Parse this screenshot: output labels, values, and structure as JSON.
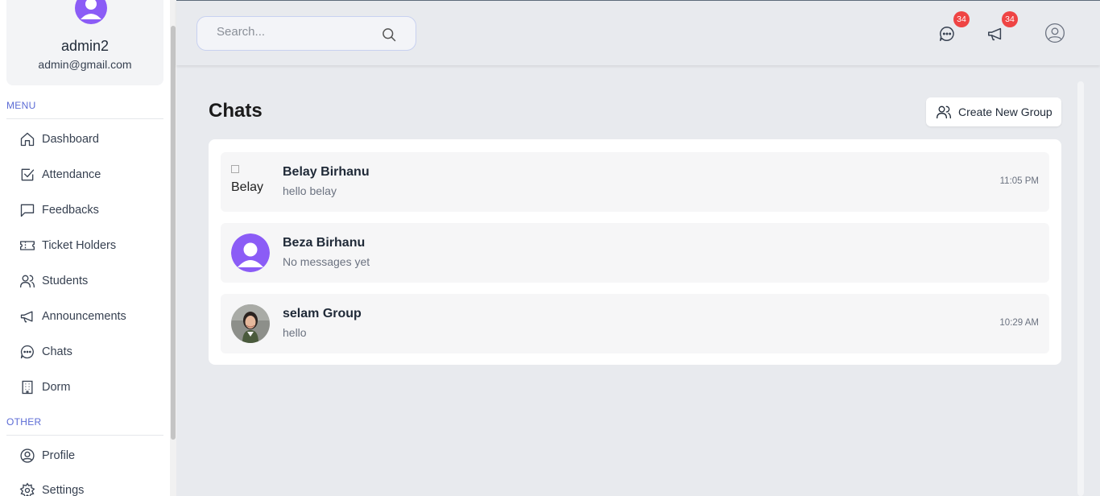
{
  "user": {
    "name": "admin2",
    "email": "admin@gmail.com"
  },
  "sidebar": {
    "menu_label": "MENU",
    "other_label": "OTHER",
    "items": [
      {
        "label": "Dashboard",
        "icon": "home-icon"
      },
      {
        "label": "Attendance",
        "icon": "check-square-icon"
      },
      {
        "label": "Feedbacks",
        "icon": "message-square-icon"
      },
      {
        "label": "Ticket Holders",
        "icon": "ticket-icon"
      },
      {
        "label": "Students",
        "icon": "users-icon"
      },
      {
        "label": "Announcements",
        "icon": "megaphone-icon"
      },
      {
        "label": "Chats",
        "icon": "chat-bubble-icon"
      },
      {
        "label": "Dorm",
        "icon": "building-icon"
      }
    ],
    "other_items": [
      {
        "label": "Profile",
        "icon": "user-circle-icon"
      },
      {
        "label": "Settings",
        "icon": "gear-icon"
      }
    ]
  },
  "topbar": {
    "search_placeholder": "Search...",
    "chat_badge": "34",
    "announcement_badge": "34"
  },
  "main": {
    "title": "Chats",
    "create_group_label": "Create New Group",
    "chats": [
      {
        "name": "Belay Birhanu",
        "message": "hello belay",
        "time": "11:05 PM",
        "avatar_alt": "Belay"
      },
      {
        "name": "Beza Birhanu",
        "message": "No messages yet",
        "time": ""
      },
      {
        "name": "selam Group",
        "message": "hello",
        "time": "10:29 AM"
      }
    ]
  },
  "colors": {
    "accent": "#5b6bd5",
    "avatar_purple": "#7c3aed",
    "badge_red": "#ef4444"
  }
}
